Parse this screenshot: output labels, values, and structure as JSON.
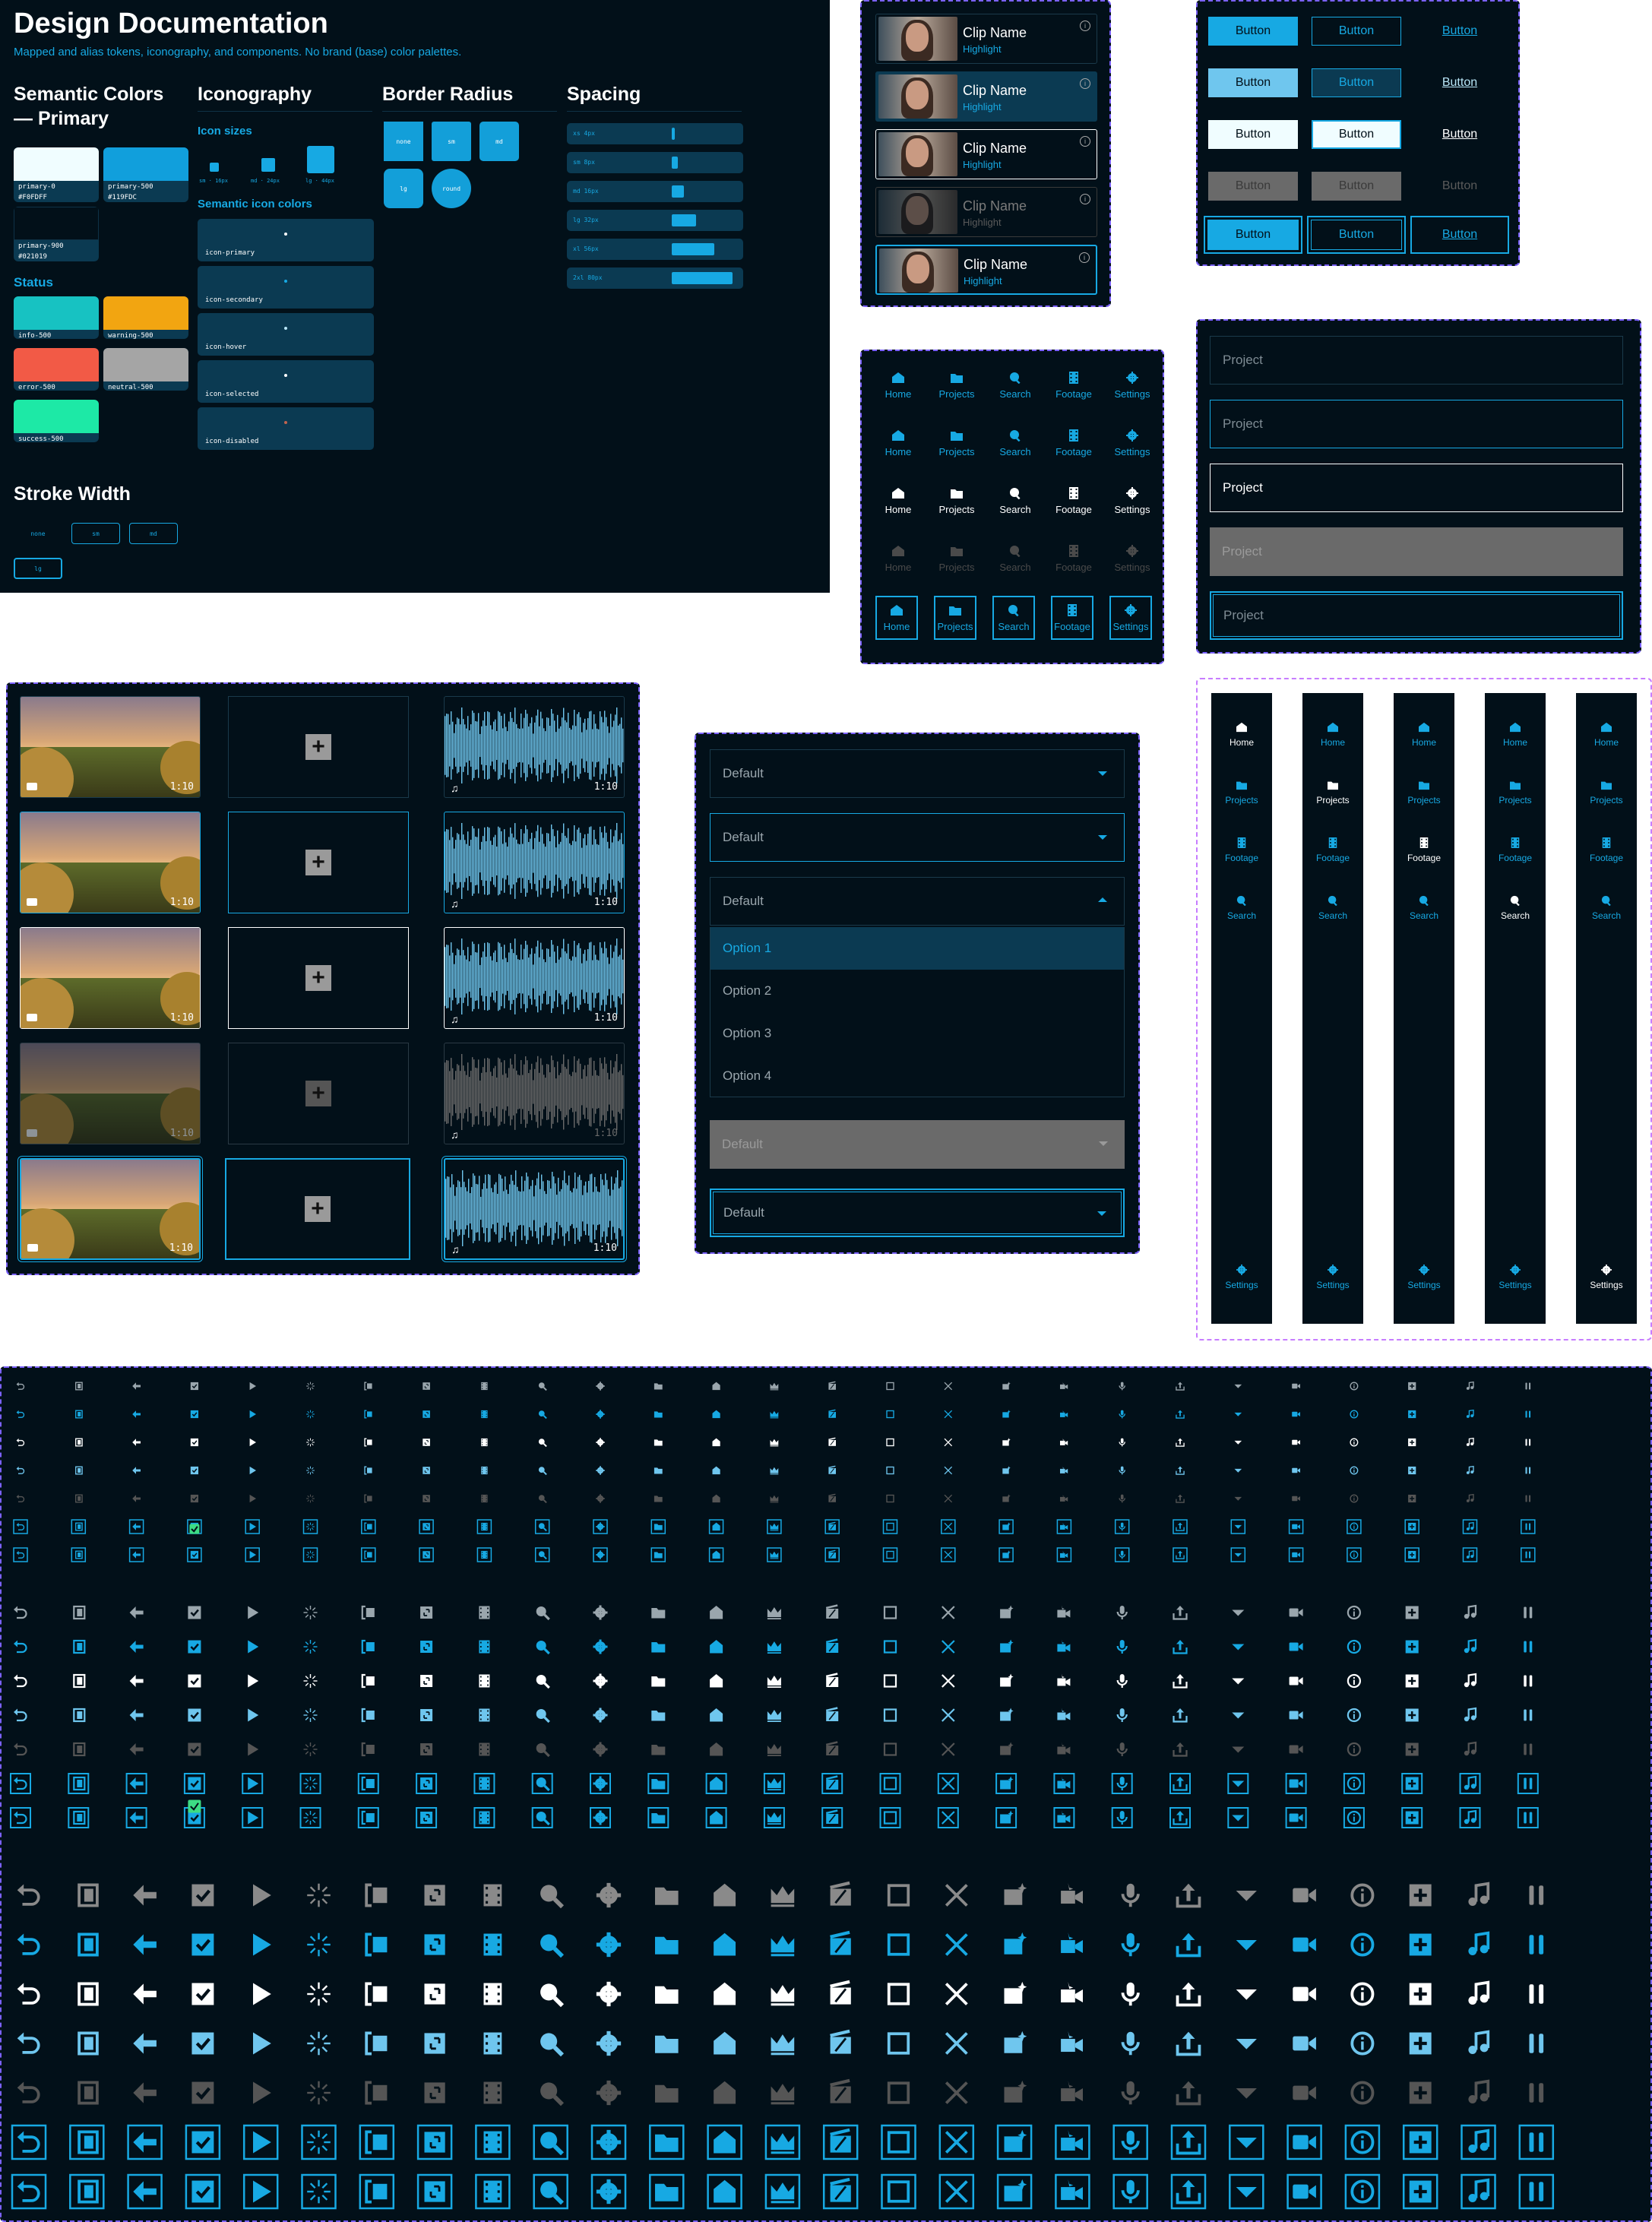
{
  "doc": {
    "title": "Design Documentation",
    "subtitle": "Mapped and alias tokens, iconography, and components. No brand (base) color palettes.",
    "sections": {
      "semantic_colors": "Semantic Colors — Primary",
      "iconography": "Iconography",
      "border_radius": "Border Radius",
      "spacing": "Spacing",
      "status": "Status",
      "stroke_width": "Stroke Width"
    },
    "primary_swatches": [
      {
        "name": "primary-0",
        "hex": "#F0FDFF",
        "color": "#F0FDFF"
      },
      {
        "name": "primary-500",
        "hex": "#119FDC",
        "color": "#119FDC"
      },
      {
        "name": "primary-900",
        "hex": "#021019",
        "color": "#021019"
      }
    ],
    "status_swatches": [
      {
        "name": "info-500",
        "color": "#17c2c2"
      },
      {
        "name": "warning-500",
        "color": "#f2a511"
      },
      {
        "name": "error-500",
        "color": "#f25a46"
      },
      {
        "name": "neutral-500",
        "color": "#a5a5a5"
      },
      {
        "name": "success-500",
        "color": "#1de9a6"
      }
    ],
    "icon_sizes_title": "Icon sizes",
    "icon_sizes": [
      "sm · 16px",
      "md · 24px",
      "lg · 44px"
    ],
    "semantic_icon_colors_title": "Semantic icon colors",
    "icon_tokens": [
      {
        "name": "icon-primary",
        "color": "#ffffff"
      },
      {
        "name": "icon-secondary",
        "color": "#17a9e3"
      },
      {
        "name": "icon-hover",
        "color": "#b9e6f7"
      },
      {
        "name": "icon-selected",
        "color": "#ffffff"
      },
      {
        "name": "icon-disabled",
        "color": "#c0634f"
      }
    ],
    "radius": [
      "none",
      "sm",
      "md",
      "lg",
      "round"
    ],
    "spacing": [
      {
        "label": "xs 4px",
        "value": 4
      },
      {
        "label": "sm 8px",
        "value": 8
      },
      {
        "label": "md 16px",
        "value": 16
      },
      {
        "label": "lg 32px",
        "value": 32
      },
      {
        "label": "xl 56px",
        "value": 56
      },
      {
        "label": "2xl 80px",
        "value": 80
      }
    ],
    "stroke": [
      "none",
      "sm",
      "md",
      "lg"
    ]
  },
  "clips": {
    "name": "Clip Name",
    "highlight": "Highlight"
  },
  "buttons": {
    "label": "Button"
  },
  "nav": [
    "Home",
    "Projects",
    "Search",
    "Footage",
    "Settings"
  ],
  "inputs": {
    "placeholder": "Project"
  },
  "media": {
    "duration": "1:10"
  },
  "select": {
    "default": "Default",
    "options": [
      "Option 1",
      "Option 2",
      "Option 3",
      "Option 4"
    ]
  },
  "sidebar": {
    "items": [
      "Home",
      "Projects",
      "Footage",
      "Search"
    ],
    "bottom": "Settings"
  },
  "icon_set": [
    "undo",
    "film-frame",
    "arrow-left",
    "checkbox",
    "play",
    "loader",
    "bracket-frame",
    "resize",
    "film-strip",
    "search",
    "gear",
    "folder",
    "home",
    "crown",
    "clapper",
    "square",
    "close",
    "film-sparkle",
    "camera-sparkle",
    "mic-sparkle",
    "upload",
    "caret-down",
    "video-camera",
    "info",
    "plus-box",
    "music-note",
    "pause"
  ],
  "colors": {
    "accent": "#17a9e3",
    "background": "#021019",
    "panel": "#0b3a52",
    "disabled": "#6a6a6a",
    "border_focus": "#ffffff"
  }
}
